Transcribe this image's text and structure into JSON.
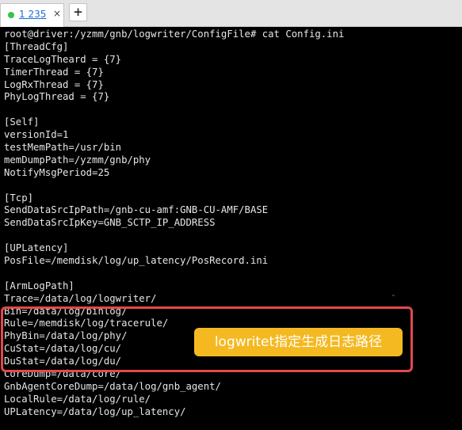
{
  "tab": {
    "label": "1 235",
    "close_glyph": "×",
    "status_color": "#35c44c"
  },
  "new_tab_glyph": "+",
  "terminal": {
    "lines": [
      "root@driver:/yzmm/gnb/logwriter/ConfigFile# cat Config.ini",
      "[ThreadCfg]",
      "TraceLogTheard = {7}",
      "TimerThread = {7}",
      "LogRxThread = {7}",
      "PhyLogThread = {7}",
      "",
      "[Self]",
      "versionId=1",
      "testMemPath=/usr/bin",
      "memDumpPath=/yzmm/gnb/phy",
      "NotifyMsgPeriod=25",
      "",
      "[Tcp]",
      "SendDataSrcIpPath=/gnb-cu-amf:GNB-CU-AMF/BASE",
      "SendDataSrcIpKey=GNB_SCTP_IP_ADDRESS",
      "",
      "[UPLatency]",
      "PosFile=/memdisk/log/up_latency/PosRecord.ini",
      "",
      "[ArmLogPath]",
      "Trace=/data/log/logwriter/",
      "Bin=/data/log/binlog/",
      "Rule=/memdisk/log/tracerule/",
      "PhyBin=/data/log/phy/",
      "CuStat=/data/log/cu/",
      "DuStat=/data/log/du/",
      "CoreDump=/data/core/",
      "GnbAgentCoreDump=/data/log/gnb_agent/",
      "LocalRule=/data/log/rule/",
      "UPLatency=/data/log/up_latency/"
    ],
    "stray_mark": "-"
  },
  "annotation": {
    "callout_text": "logwritet指定生成日志路径",
    "box_color": "#e14a4a",
    "callout_color": "#f4b921"
  }
}
